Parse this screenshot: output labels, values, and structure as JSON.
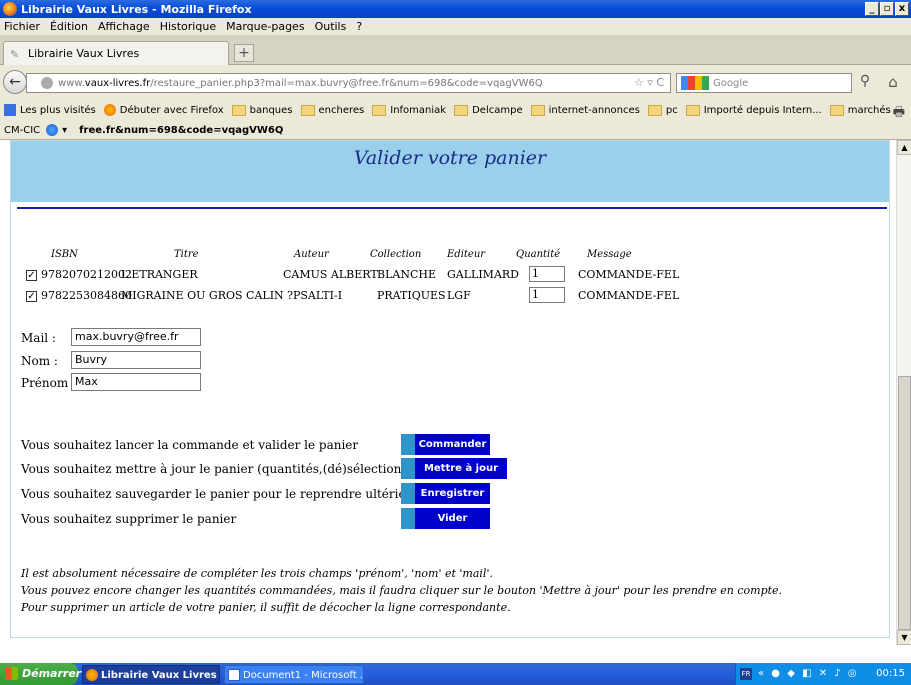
{
  "window": {
    "title": "Librairie Vaux Livres - Mozilla Firefox",
    "controls": [
      "_",
      "▫",
      "x"
    ]
  },
  "menu": [
    "Fichier",
    "Édition",
    "Affichage",
    "Historique",
    "Marque-pages",
    "Outils",
    "?"
  ],
  "tab": {
    "label": "Librairie Vaux Livres",
    "new_tab": "+"
  },
  "address": {
    "prefix": "www.",
    "host": "vaux-livres.fr",
    "path": "/restaure_panier.php3?mail=max.buvry@free.fr&num=698&code=vqagVW6Q"
  },
  "search": {
    "placeholder": "Google"
  },
  "bookmarks": [
    "Les plus visités",
    "Débuter avec Firefox",
    "banques",
    "encheres",
    "Infomaniak",
    "Delcampe",
    "internet-annonces",
    "pc",
    "Importé depuis Intern...",
    "marchés"
  ],
  "addon": {
    "label": "CM-CIC",
    "text": "free.fr&num=698&code=vqagVW6Q"
  },
  "page": {
    "heading": "Valider votre panier",
    "table": {
      "headers": [
        "ISBN",
        "Titre",
        "Auteur",
        "Collection",
        "Editeur",
        "Quantité",
        "Message"
      ],
      "rows": [
        {
          "isbn": "9782070212002",
          "titre": "L'ETRANGER",
          "auteur": "CAMUS ALBERT",
          "collection": "BLANCHE",
          "editeur": "GALLIMARD",
          "quantite": "1",
          "message": "COMMANDE-FEL",
          "checked": true
        },
        {
          "isbn": "9782253084860",
          "titre": "MIGRAINE OU GROS CALIN ?",
          "auteur": "PSALTI-I",
          "collection": "PRATIQUES",
          "editeur": "LGF",
          "quantite": "1",
          "message": "COMMANDE-FEL",
          "checked": true
        }
      ]
    },
    "form": {
      "mail_label": "Mail :",
      "mail_value": "max.buvry@free.fr",
      "nom_label": "Nom :",
      "nom_value": "Buvry",
      "prenom_label": "Prénom :",
      "prenom_value": "Max"
    },
    "actions": [
      {
        "text": "Vous souhaitez lancer la commande et valider le panier",
        "button": "Commander"
      },
      {
        "text": "Vous souhaitez mettre à jour le panier (quantités,(dé)sélection)",
        "button": "Mettre à jour"
      },
      {
        "text": "Vous souhaitez sauvegarder le panier pour le reprendre ultérieurement",
        "button": "Enregistrer"
      },
      {
        "text": "Vous souhaitez supprimer le panier",
        "button": "Vider"
      }
    ],
    "notes": [
      "Il est absolument nécessaire de compléter les trois champs 'prénom', 'nom' et 'mail'.",
      "Vous pouvez encore changer les quantités commandées, mais il faudra cliquer sur le bouton 'Mettre à jour' pour les prendre en compte.",
      "Pour supprimer un article de votre panier, il suffit de décocher la ligne correspondante."
    ]
  },
  "taskbar": {
    "start": "Démarrer",
    "items": [
      "Librairie Vaux Livres -...",
      "Document1 - Microsoft ..."
    ],
    "tray_lang": "FR",
    "clock": "00:15"
  },
  "colors": {
    "banner": "#9bd0eb",
    "heading": "#1a2a8a",
    "rule": "#1b1bb0",
    "button": "#0000cc",
    "button_accent": "#2f95c8"
  }
}
